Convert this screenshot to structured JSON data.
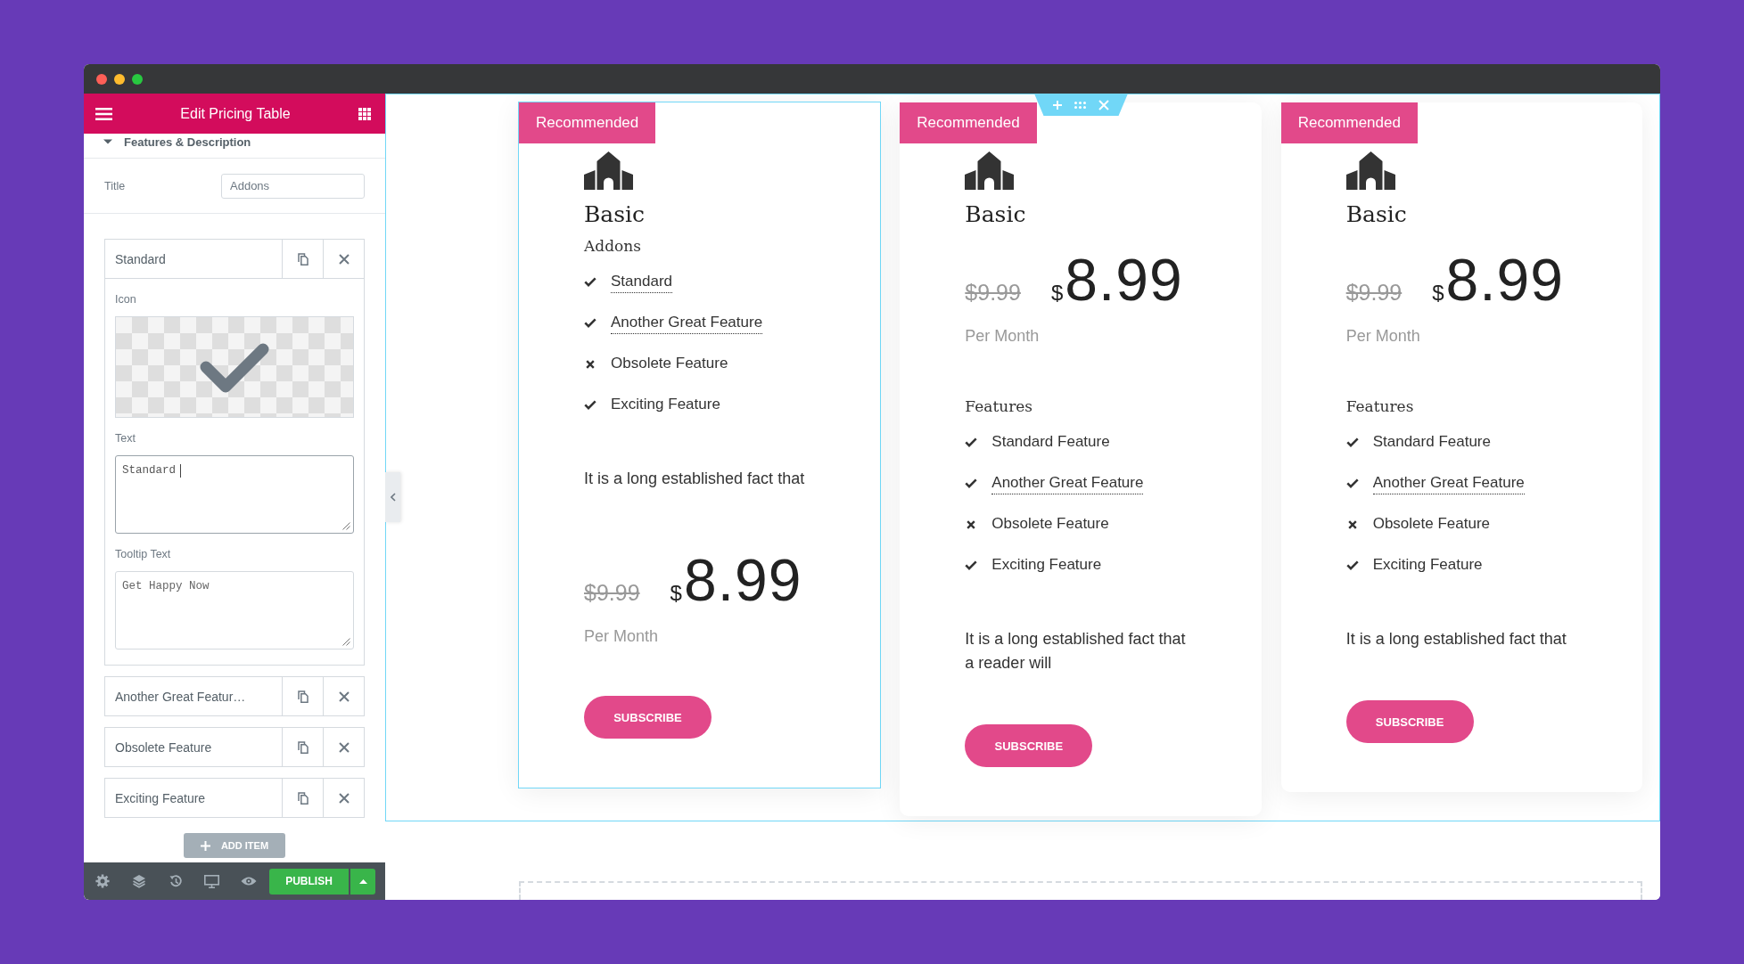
{
  "panel": {
    "title": "Edit Pricing Table",
    "section": {
      "title": "Features & Description",
      "expanded": true
    },
    "title_field": {
      "label": "Title",
      "value": "Addons"
    },
    "items": [
      {
        "label": "Standard",
        "expanded": true,
        "icon_label": "Icon",
        "text_field": {
          "label": "Text",
          "value": "Standard",
          "focused": true
        },
        "tooltip_field": {
          "label": "Tooltip Text",
          "value": "Get Happy Now",
          "focused": false
        }
      },
      {
        "label": "Another Great Featur…",
        "expanded": false
      },
      {
        "label": "Obsolete Feature",
        "expanded": false
      },
      {
        "label": "Exciting Feature",
        "expanded": false
      }
    ],
    "add_button": "ADD ITEM",
    "publish_button": "PUBLISH"
  },
  "section": {
    "selected": true
  },
  "cards": [
    {
      "selected": true,
      "ribbon": "Recommended",
      "title": "Basic",
      "subtitle": "Addons",
      "blocks": [
        {
          "kind": "features",
          "items": [
            {
              "text": "Standard",
              "included": true,
              "tooltip": true
            },
            {
              "text": "Another Great Feature",
              "included": true,
              "tooltip": true
            },
            {
              "text": "Obsolete Feature",
              "included": false,
              "tooltip": false
            },
            {
              "text": "Exciting Feature",
              "included": true,
              "tooltip": false
            }
          ]
        },
        {
          "kind": "description",
          "text": "It is a long established fact that"
        },
        {
          "kind": "price",
          "old_price": "$9.99",
          "currency": "$",
          "amount": "8.99",
          "period": "Per Month"
        },
        {
          "kind": "button",
          "label": "SUBSCRIBE"
        }
      ]
    },
    {
      "selected": false,
      "ribbon": "Recommended",
      "title": "Basic",
      "blocks": [
        {
          "kind": "price",
          "old_price": "$9.99",
          "currency": "$",
          "amount": "8.99",
          "period": "Per Month"
        },
        {
          "kind": "features",
          "heading": "Features",
          "items": [
            {
              "text": "Standard Feature",
              "included": true,
              "tooltip": false
            },
            {
              "text": "Another Great Feature",
              "included": true,
              "tooltip": true
            },
            {
              "text": "Obsolete Feature",
              "included": false,
              "tooltip": false
            },
            {
              "text": "Exciting Feature",
              "included": true,
              "tooltip": false
            }
          ]
        },
        {
          "kind": "description",
          "text": "It is a long established fact that a reader will"
        },
        {
          "kind": "button",
          "label": "SUBSCRIBE"
        }
      ]
    },
    {
      "selected": false,
      "ribbon": "Recommended",
      "title": "Basic",
      "blocks": [
        {
          "kind": "price",
          "old_price": "$9.99",
          "currency": "$",
          "amount": "8.99",
          "period": "Per Month"
        },
        {
          "kind": "features",
          "heading": "Features",
          "items": [
            {
              "text": "Standard Feature",
              "included": true,
              "tooltip": false
            },
            {
              "text": "Another Great Feature",
              "included": true,
              "tooltip": true
            },
            {
              "text": "Obsolete Feature",
              "included": false,
              "tooltip": false
            },
            {
              "text": "Exciting Feature",
              "included": true,
              "tooltip": false
            }
          ]
        },
        {
          "kind": "description",
          "text": "It is a long established fact that"
        },
        {
          "kind": "button",
          "label": "SUBSCRIBE"
        }
      ]
    }
  ]
}
